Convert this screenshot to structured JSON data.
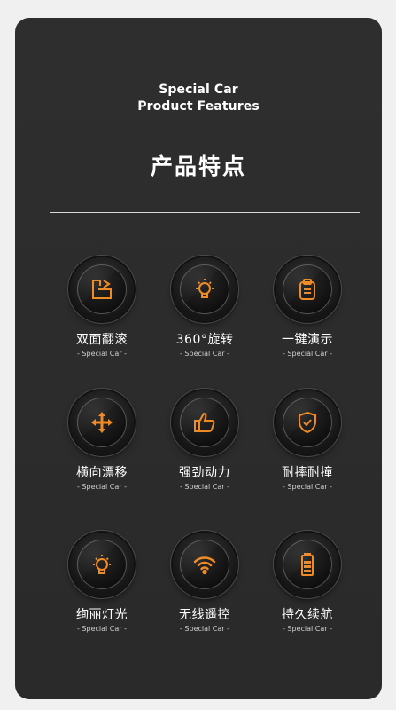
{
  "header": {
    "line1": "Special Car",
    "line2": "Product Features",
    "title_cn": "产品特点"
  },
  "accent_color": "#f08a24",
  "features": [
    {
      "title": "双面翻滚",
      "sub": "- Special Car -",
      "icon": "flip-icon"
    },
    {
      "title": "360°旋转",
      "sub": "- Special Car -",
      "icon": "lightbulb-icon"
    },
    {
      "title": "一键演示",
      "sub": "- Special Car -",
      "icon": "clipboard-icon"
    },
    {
      "title": "横向漂移",
      "sub": "- Special Car -",
      "icon": "move-arrows-icon"
    },
    {
      "title": "强劲动力",
      "sub": "- Special Car -",
      "icon": "thumbs-up-icon"
    },
    {
      "title": "耐摔耐撞",
      "sub": "- Special Car -",
      "icon": "shield-check-icon"
    },
    {
      "title": "绚丽灯光",
      "sub": "- Special Car -",
      "icon": "light-icon"
    },
    {
      "title": "无线遥控",
      "sub": "- Special Car -",
      "icon": "wifi-icon"
    },
    {
      "title": "持久续航",
      "sub": "- Special Car -",
      "icon": "battery-icon"
    }
  ]
}
